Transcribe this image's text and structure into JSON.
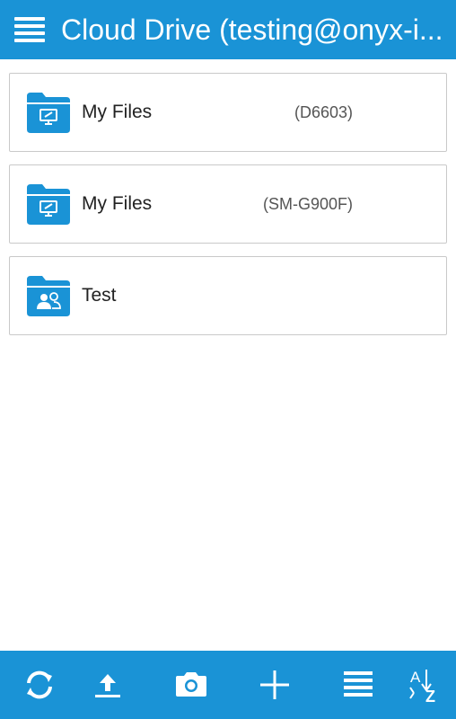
{
  "header": {
    "title": "Cloud Drive (testing@onyx-i...",
    "menu_icon": "hamburger-menu-icon",
    "background": "#1a93d6"
  },
  "folders": [
    {
      "label": "My Files",
      "device": "(D6603)",
      "icon": "desktop-folder-icon"
    },
    {
      "label": "My Files",
      "device": "(SM-G900F)",
      "icon": "desktop-folder-icon"
    },
    {
      "label": "Test",
      "device": "",
      "icon": "shared-folder-icon"
    }
  ],
  "toolbar": {
    "items": [
      {
        "name": "refresh",
        "icon": "refresh-icon"
      },
      {
        "name": "upload",
        "icon": "upload-icon"
      },
      {
        "name": "camera",
        "icon": "camera-icon"
      },
      {
        "name": "add",
        "icon": "plus-icon"
      },
      {
        "name": "view-list",
        "icon": "list-view-icon"
      },
      {
        "name": "sort",
        "icon": "sort-az-icon"
      }
    ]
  },
  "colors": {
    "accent": "#1a93d6",
    "folder": "#1a93d6"
  }
}
